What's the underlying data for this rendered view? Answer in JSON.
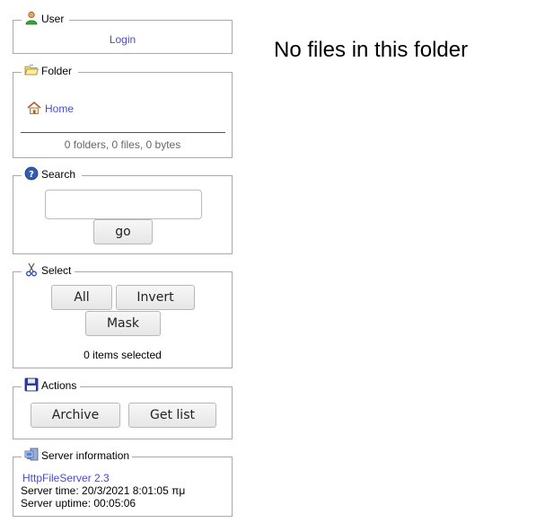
{
  "user": {
    "title": "User",
    "login_label": "Login"
  },
  "folder": {
    "title": "Folder",
    "home_label": "Home",
    "summary": "0 folders, 0 files, 0 bytes"
  },
  "search": {
    "title": "Search",
    "query": "",
    "go_label": "go"
  },
  "select": {
    "title": "Select",
    "all_label": "All",
    "invert_label": "Invert",
    "mask_label": "Mask",
    "status": "0 items selected"
  },
  "actions": {
    "title": "Actions",
    "archive_label": "Archive",
    "getlist_label": "Get list"
  },
  "server": {
    "title": "Server information",
    "version_link": "HttpFileServer 2.3",
    "time_line": "Server time: 20/3/2021 8:01:05 πμ",
    "uptime_line": "Server uptime: 00:05:06"
  },
  "main": {
    "message": "No files in this folder"
  },
  "icons": [
    "user-icon",
    "folder-open-icon",
    "home-icon",
    "help-icon",
    "scissors-icon",
    "floppy-disk-icon",
    "server-icon"
  ]
}
